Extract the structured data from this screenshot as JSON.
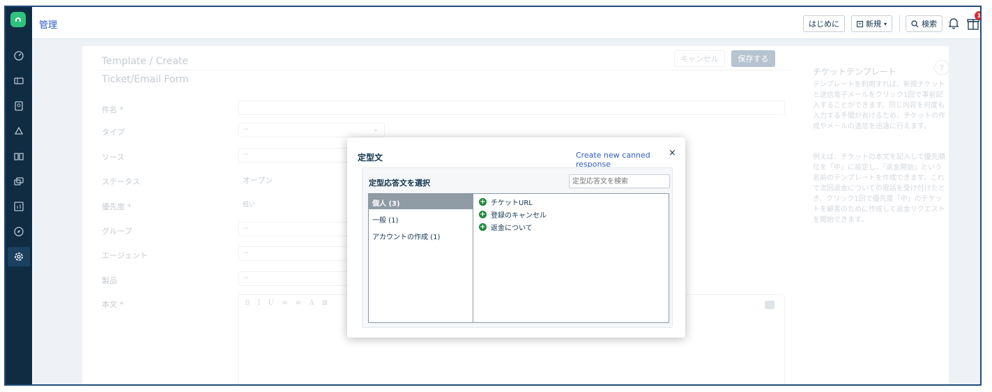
{
  "topbar": {
    "app_title": "管理",
    "getting_started": "はじめに",
    "new_label": "新規",
    "search_label": "検索",
    "notification_count": "1"
  },
  "form": {
    "breadcrumb": "Template / Create",
    "title": "Ticket/Email Form",
    "cancel": "キャンセル",
    "save": "保存する",
    "fields": {
      "subject": "件名 *",
      "type": "タイプ",
      "source": "ソース",
      "status": "ステータス",
      "priority": "優先度 *",
      "group": "グループ",
      "agent": "エージェント",
      "product": "製品",
      "body": "本文 *"
    },
    "values": {
      "type": "--",
      "source": "--",
      "status": "オープン",
      "priority": "低い",
      "group": "--",
      "agent": "--",
      "product": "--"
    },
    "toolbar": "B I U ≡ ≡ A ⊠"
  },
  "help": {
    "title": "チケットテンプレート",
    "para1": "テンプレートを利用すれば、新規チケットと送信電子メールをクリック1回で事前記入することができます。同じ内容を何度も入力する手間が省けるため、チケットの作成やメールの送信を迅速に行えます。",
    "para2": "例えば、チケットの本文を記入して優先順位を「中」に設定し、「返金開始」という名前のテンプレートを作成できます。これで次回返金についての電話を受け付けたとき、クリック1回で優先度「中」のチケットを顧客のために作成して返金リクエストを開始できます。"
  },
  "modal": {
    "title": "定型文",
    "create_link": "Create new canned response",
    "close": "×",
    "select_title": "定型応答文を選択",
    "search_placeholder": "定型応答文を検索",
    "categories": [
      {
        "label": "個人 (3)"
      },
      {
        "label": "一般 (1)"
      },
      {
        "label": "アカウントの作成 (1)"
      }
    ],
    "responses": [
      {
        "label": "チケットURL"
      },
      {
        "label": "登録のキャンセル"
      },
      {
        "label": "返金について"
      }
    ]
  }
}
